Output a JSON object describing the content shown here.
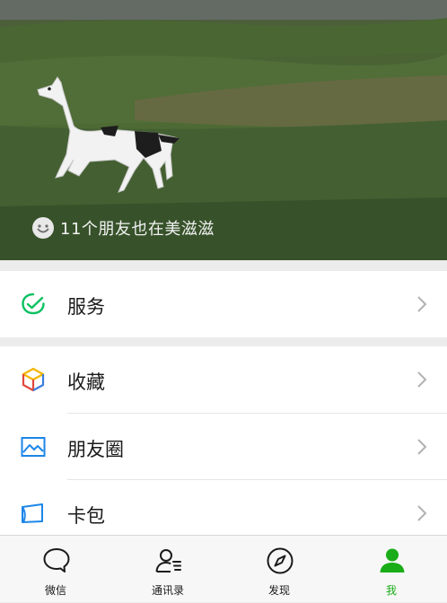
{
  "header": {
    "status_text": "11个朋友也在美滋滋"
  },
  "menu": {
    "group1": [
      {
        "label": "服务",
        "icon": "service-icon"
      }
    ],
    "group2": [
      {
        "label": "收藏",
        "icon": "favorites-cube-icon"
      },
      {
        "label": "朋友圈",
        "icon": "moments-photo-icon"
      },
      {
        "label": "卡包",
        "icon": "card-wallet-icon"
      }
    ]
  },
  "tabbar": {
    "tabs": [
      {
        "label": "微信",
        "icon": "chat-bubble-icon",
        "active": false
      },
      {
        "label": "通讯录",
        "icon": "contacts-icon",
        "active": false
      },
      {
        "label": "发现",
        "icon": "compass-icon",
        "active": false
      },
      {
        "label": "我",
        "icon": "profile-icon",
        "active": true
      }
    ]
  },
  "colors": {
    "accent": "#1aad19",
    "background": "#ececec",
    "service_icon": "#07c160",
    "photo_icon": "#1c86e8"
  }
}
